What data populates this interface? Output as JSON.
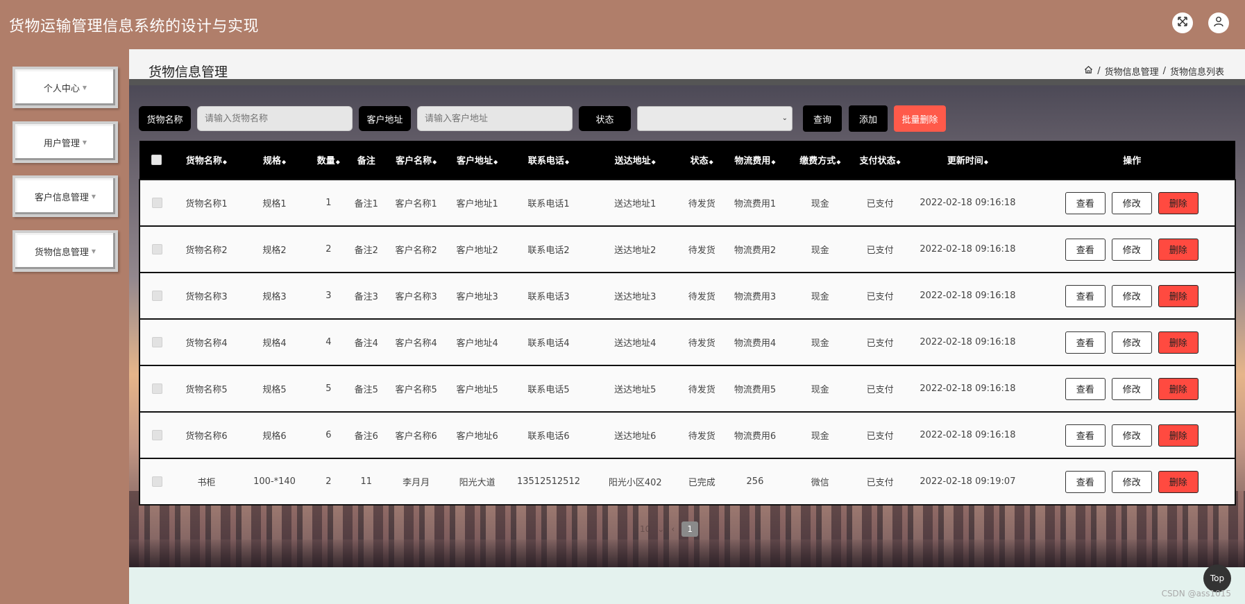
{
  "app": {
    "title": "货物运输管理信息系统的设计与实现"
  },
  "header": {
    "fullscreen_icon": "fullscreen-icon",
    "user_icon": "user-icon"
  },
  "sidebar": {
    "items": [
      {
        "label": "个人中心"
      },
      {
        "label": "用户管理"
      },
      {
        "label": "客户信息管理"
      },
      {
        "label": "货物信息管理"
      }
    ]
  },
  "page": {
    "title": "货物信息管理",
    "breadcrumb": [
      "货物信息管理",
      "货物信息列表"
    ],
    "breadcrumb_sep": "/"
  },
  "search": {
    "name_label": "货物名称",
    "name_placeholder": "请输入货物名称",
    "addr_label": "客户地址",
    "addr_placeholder": "请输入客户地址",
    "status_label": "状态",
    "status_value": "",
    "query_label": "查询",
    "add_label": "添加",
    "batch_delete_label": "批量删除"
  },
  "table": {
    "columns": [
      "货物名称",
      "规格",
      "数量",
      "备注",
      "客户名称",
      "客户地址",
      "联系电话",
      "送达地址",
      "状态",
      "物流费用",
      "缴费方式",
      "支付状态",
      "更新时间",
      "操作"
    ],
    "sortable": [
      true,
      true,
      true,
      false,
      true,
      true,
      true,
      true,
      true,
      true,
      true,
      true,
      true,
      false
    ],
    "rows": [
      [
        "货物名称1",
        "规格1",
        "1",
        "备注1",
        "客户名称1",
        "客户地址1",
        "联系电话1",
        "送达地址1",
        "待发货",
        "物流费用1",
        "现金",
        "已支付",
        "2022-02-18 09:16:18"
      ],
      [
        "货物名称2",
        "规格2",
        "2",
        "备注2",
        "客户名称2",
        "客户地址2",
        "联系电话2",
        "送达地址2",
        "待发货",
        "物流费用2",
        "现金",
        "已支付",
        "2022-02-18 09:16:18"
      ],
      [
        "货物名称3",
        "规格3",
        "3",
        "备注3",
        "客户名称3",
        "客户地址3",
        "联系电话3",
        "送达地址3",
        "待发货",
        "物流费用3",
        "现金",
        "已支付",
        "2022-02-18 09:16:18"
      ],
      [
        "货物名称4",
        "规格4",
        "4",
        "备注4",
        "客户名称4",
        "客户地址4",
        "联系电话4",
        "送达地址4",
        "待发货",
        "物流费用4",
        "现金",
        "已支付",
        "2022-02-18 09:16:18"
      ],
      [
        "货物名称5",
        "规格5",
        "5",
        "备注5",
        "客户名称5",
        "客户地址5",
        "联系电话5",
        "送达地址5",
        "待发货",
        "物流费用5",
        "现金",
        "已支付",
        "2022-02-18 09:16:18"
      ],
      [
        "货物名称6",
        "规格6",
        "6",
        "备注6",
        "客户名称6",
        "客户地址6",
        "联系电话6",
        "送达地址6",
        "待发货",
        "物流费用6",
        "现金",
        "已支付",
        "2022-02-18 09:16:18"
      ],
      [
        "书柜",
        "100-*140",
        "2",
        "11",
        "李月月",
        "阳光大道",
        "13512512512",
        "阳光小区402",
        "已完成",
        "256",
        "微信",
        "已支付",
        "2022-02-18 09:19:07"
      ]
    ],
    "actions": {
      "view": "查看",
      "edit": "修改",
      "delete": "删除"
    }
  },
  "pagination": {
    "page_size": "10",
    "current_page": "1"
  },
  "top_button": "Top",
  "watermark": "CSDN @ass1015",
  "colors": {
    "header_bg": "#b07e6a",
    "delete_red": "#ff4a40",
    "batch_red": "#ff5a4a"
  }
}
